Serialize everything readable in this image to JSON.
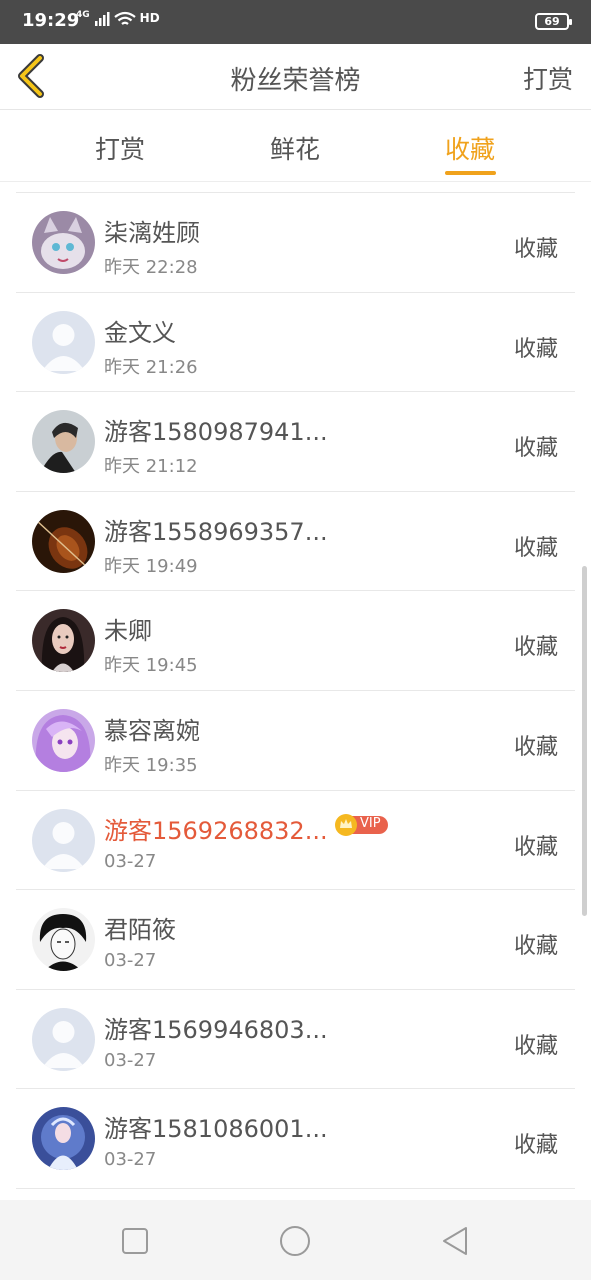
{
  "status": {
    "time": "19:29",
    "net": "4G",
    "hd": "HD",
    "battery": "69"
  },
  "nav": {
    "title": "粉丝荣誉榜",
    "right": "打赏"
  },
  "tabs": [
    {
      "label": "打赏"
    },
    {
      "label": "鲜花"
    },
    {
      "label": "收藏"
    }
  ],
  "active_tab": "收藏",
  "accent_color": "#f0a21c",
  "vip_name_color": "#e45a3a",
  "rows": [
    {
      "name": "柒漓姓顾",
      "time": "昨天 22:28",
      "action": "收藏",
      "avatar": "cartoon-cat-avatar"
    },
    {
      "name": "金文义",
      "time": "昨天 21:26",
      "action": "收藏",
      "avatar": "default-avatar"
    },
    {
      "name": "游客1580987941...",
      "time": "昨天 21:12",
      "action": "收藏",
      "avatar": "man-portrait-avatar"
    },
    {
      "name": "游客1558969357...",
      "time": "昨天 19:49",
      "action": "收藏",
      "avatar": "violin-avatar"
    },
    {
      "name": "未卿",
      "time": "昨天 19:45",
      "action": "收藏",
      "avatar": "girl-portrait-avatar"
    },
    {
      "name": "慕容离婉",
      "time": "昨天 19:35",
      "action": "收藏",
      "avatar": "anime-girl-avatar"
    },
    {
      "name": "游客1569268832...",
      "time": "03-27",
      "action": "收藏",
      "avatar": "default-avatar",
      "vip": "VIP"
    },
    {
      "name": "君陌筱",
      "time": "03-27",
      "action": "收藏",
      "avatar": "sketch-boy-avatar"
    },
    {
      "name": "游客1569946803...",
      "time": "03-27",
      "action": "收藏",
      "avatar": "default-avatar"
    },
    {
      "name": "游客1581086001...",
      "time": "03-27",
      "action": "收藏",
      "avatar": "fantasy-girl-avatar"
    }
  ]
}
